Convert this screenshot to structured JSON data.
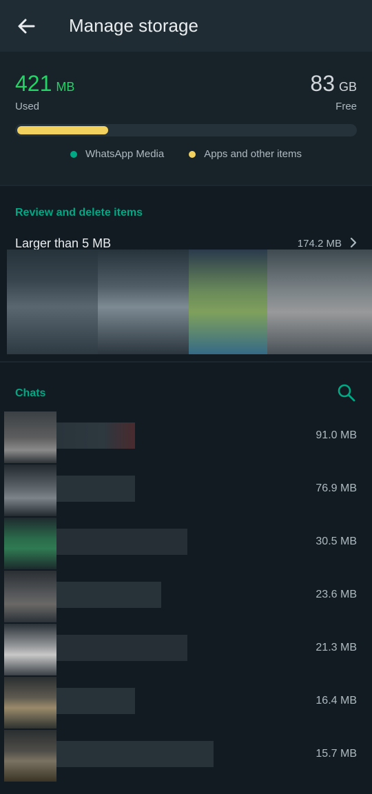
{
  "app_bar": {
    "title": "Manage storage",
    "back_icon": "arrow-left-icon"
  },
  "storage": {
    "used_value": "421",
    "used_unit": "MB",
    "used_label": "Used",
    "free_value": "83",
    "free_unit": "GB",
    "free_label": "Free",
    "usage_fraction": 0.27,
    "legend": [
      {
        "label": "WhatsApp Media",
        "color": "#00a884"
      },
      {
        "label": "Apps and other items",
        "color": "#f2d15e"
      }
    ]
  },
  "review": {
    "section_title": "Review and delete items",
    "larger_label": "Larger than 5 MB",
    "larger_size": "174.2 MB",
    "chevron_icon": "chevron-right-icon"
  },
  "chats": {
    "section_title": "Chats",
    "search_icon": "search-icon",
    "items": [
      {
        "size": "91.0 MB"
      },
      {
        "size": "76.9 MB"
      },
      {
        "size": "30.5 MB"
      },
      {
        "size": "23.6 MB"
      },
      {
        "size": "21.3 MB"
      },
      {
        "size": "16.4 MB"
      },
      {
        "size": "15.7 MB"
      }
    ]
  },
  "colors": {
    "accent": "#00a884",
    "apps_yellow": "#f2d15e",
    "background": "#121b22"
  }
}
